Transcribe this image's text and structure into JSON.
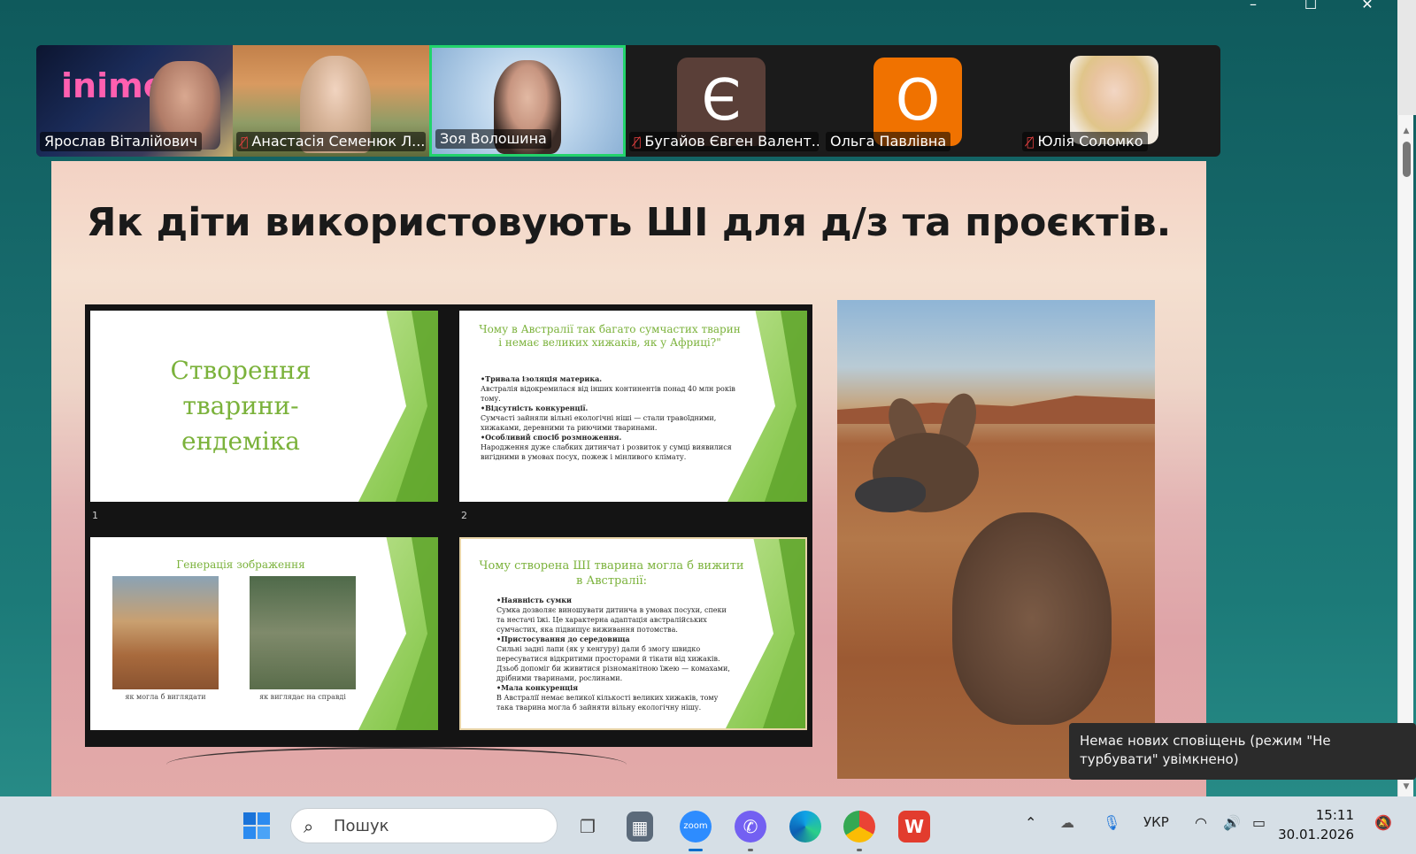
{
  "window": {
    "minimize": "–",
    "maximize": "☐",
    "close": "✕"
  },
  "participants": [
    {
      "name": "Ярослав Віталійович",
      "muted": false,
      "video": true,
      "overlay_text": "inimeƏ"
    },
    {
      "name": "Анастасія Семенюк Л...",
      "muted": true,
      "video": true
    },
    {
      "name": "Зоя Волошина",
      "muted": false,
      "video": true,
      "active": true
    },
    {
      "name": "Бугайов Євген Валент...",
      "muted": true,
      "video": false,
      "initial": "Є",
      "avatar_color": "#5a3f38"
    },
    {
      "name": "Ольга Павлівна",
      "muted": false,
      "video": false,
      "initial": "О",
      "avatar_color": "#f07200"
    },
    {
      "name": "Юлія Соломко",
      "muted": true,
      "video": true
    }
  ],
  "slide": {
    "title": "Як діти використовують ШІ для д/з та проєктів.",
    "thumbs": {
      "s1": {
        "title": "Створення тварини-ендеміка",
        "number": "1"
      },
      "s2": {
        "number": "2",
        "title": "Чому в Австралії так багато сумчастих тварин і немає великих хижаків, як у Африці?\"",
        "b1": "•Тривала ізоляція материка.",
        "t1": "Австралія відокремилася від інших континентів понад 40 млн років тому.",
        "b2": "•Відсутність конкуренції.",
        "t2": "Сумчасті зайняли вільні екологічні ніші — стали травоїдними, хижаками, деревними та риючими тваринами.",
        "b3": "•Особливий спосіб розмноження.",
        "t3": "Народження дуже слабких дитинчат і розвиток у сумці виявилися вигідними в умовах посух, пожеж і мінливого клімату."
      },
      "s3": {
        "title": "Генерація зображення",
        "cap1": "як могла б виглядати",
        "cap2": "як виглядає на справді"
      },
      "s4": {
        "title": "Чому створена ШІ тварина могла б вижити в Австралії:",
        "b1": "•Наявність сумки",
        "t1": "Сумка дозволяє виношувати дитинча в умовах посухи, спеки та нестачі їжі. Це характерна адаптація австралійських сумчастих, яка підвищує виживання потомства.",
        "b2": "•Пристосування до середовища",
        "t2": "Сильні задні лапи (як у кенгуру) дали б змогу швидко пересуватися відкритими просторами й тікати від хижаків. Дзьоб допоміг би живитися різноманітною їжею — комахами, дрібними тваринами, рослинами.",
        "b3": "•Мала конкуренція",
        "t3": "В Австралії немає великої кількості великих хижаків, тому така тварина могла б зайняти вільну екологічну нішу."
      }
    }
  },
  "notification": {
    "text": "Немає нових сповіщень (режим \"Не турбувати\" увімкнено)"
  },
  "taskbar": {
    "search_placeholder": "Пошук",
    "zoom_label": "zoom",
    "lang": "УКР",
    "time": "15:11",
    "date": "30.01.2026"
  },
  "colors": {
    "accent_green": "#22d36b",
    "slide_green": "#7bb23b",
    "taskbar_active": "#0b6cc9"
  }
}
